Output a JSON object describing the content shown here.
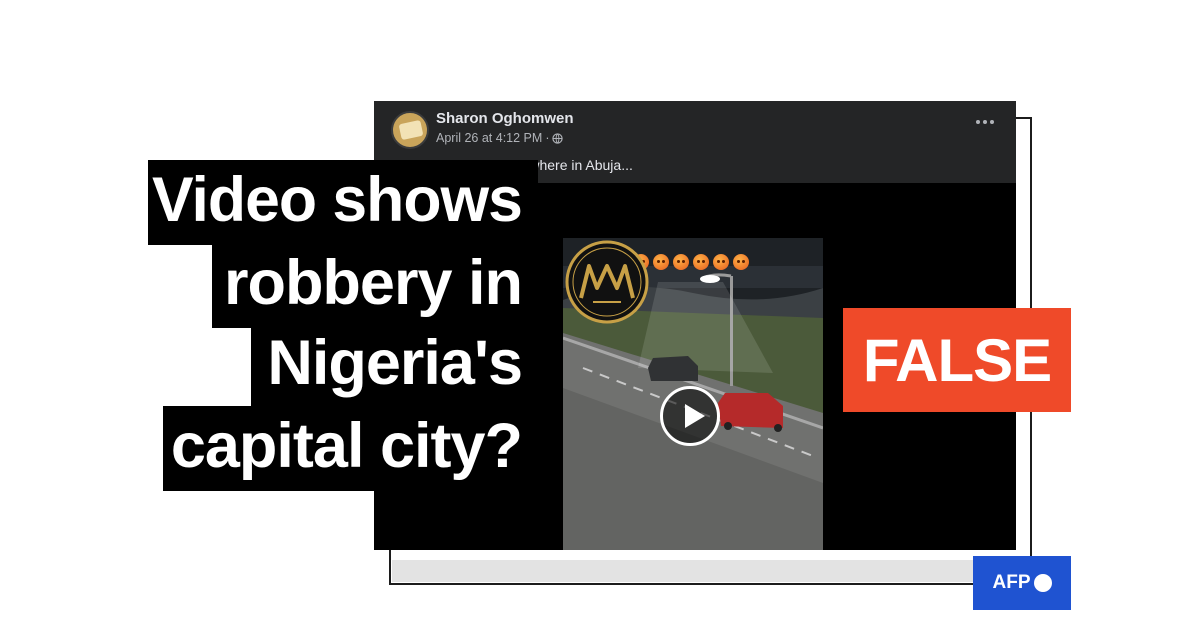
{
  "post": {
    "author": "Sharon Oghomwen",
    "time": "April 26 at 4:12 PM",
    "separator": "·",
    "text": "...fic light somewhere in Abuja...",
    "more_icon": "more-dots-icon",
    "privacy_icon": "globe-icon"
  },
  "video": {
    "emoji_icon": "angry-face-icon",
    "emoji_count": 6,
    "play_icon": "play-icon",
    "watermark_icon": "mm-monogram-logo"
  },
  "headline": {
    "lines": [
      "Video shows",
      "robbery in",
      "Nigeria's",
      "capital city?"
    ]
  },
  "verdict": {
    "label": "FALSE",
    "color": "#ef4a29"
  },
  "brand": {
    "label": "AFP",
    "color": "#1f53d1"
  }
}
